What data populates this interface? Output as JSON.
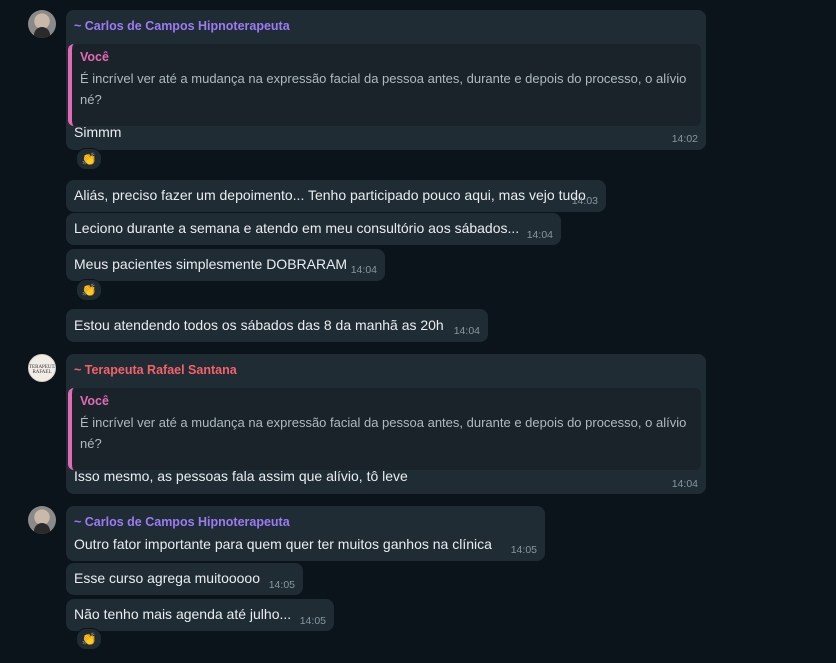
{
  "senders": {
    "carlos": {
      "name": "~ Carlos de Campos Hipnoterapeuta",
      "color": "#9b7bf5"
    },
    "rafael": {
      "name": "~ Terapeuta Rafael Santana",
      "color": "#f5616b"
    }
  },
  "avatar_rafael_text": "TERAPEUTA RAFAEL",
  "quote": {
    "author": "Você",
    "text": "É incrível ver até a mudança na expressão facial da pessoa antes, durante e depois do processo, o alívio né?"
  },
  "messages": [
    {
      "text": "Simmm",
      "time": "14:02"
    },
    {
      "text": "Aliás, preciso fazer um depoimento... Tenho participado pouco aqui, mas vejo tudo",
      "time": "14:03"
    },
    {
      "text": "Leciono durante a semana e atendo em meu consultório aos sábados...",
      "time": "14:04"
    },
    {
      "text": "Meus pacientes simplesmente DOBRARAM",
      "time": "14:04"
    },
    {
      "text": "Estou atendendo todos os sábados das 8 da manhã as  20h",
      "time": "14:04"
    },
    {
      "text": "Isso mesmo, as pessoas fala assim que alívio, tô leve",
      "time": "14:04"
    },
    {
      "text": "Outro fator importante para quem quer ter muitos ganhos na clínica",
      "time": "14:05"
    },
    {
      "text": "Esse curso agrega muitooooo",
      "time": "14:05"
    },
    {
      "text": "Não tenho mais agenda até julho...",
      "time": "14:05"
    }
  ],
  "reaction_emoji": "👏"
}
